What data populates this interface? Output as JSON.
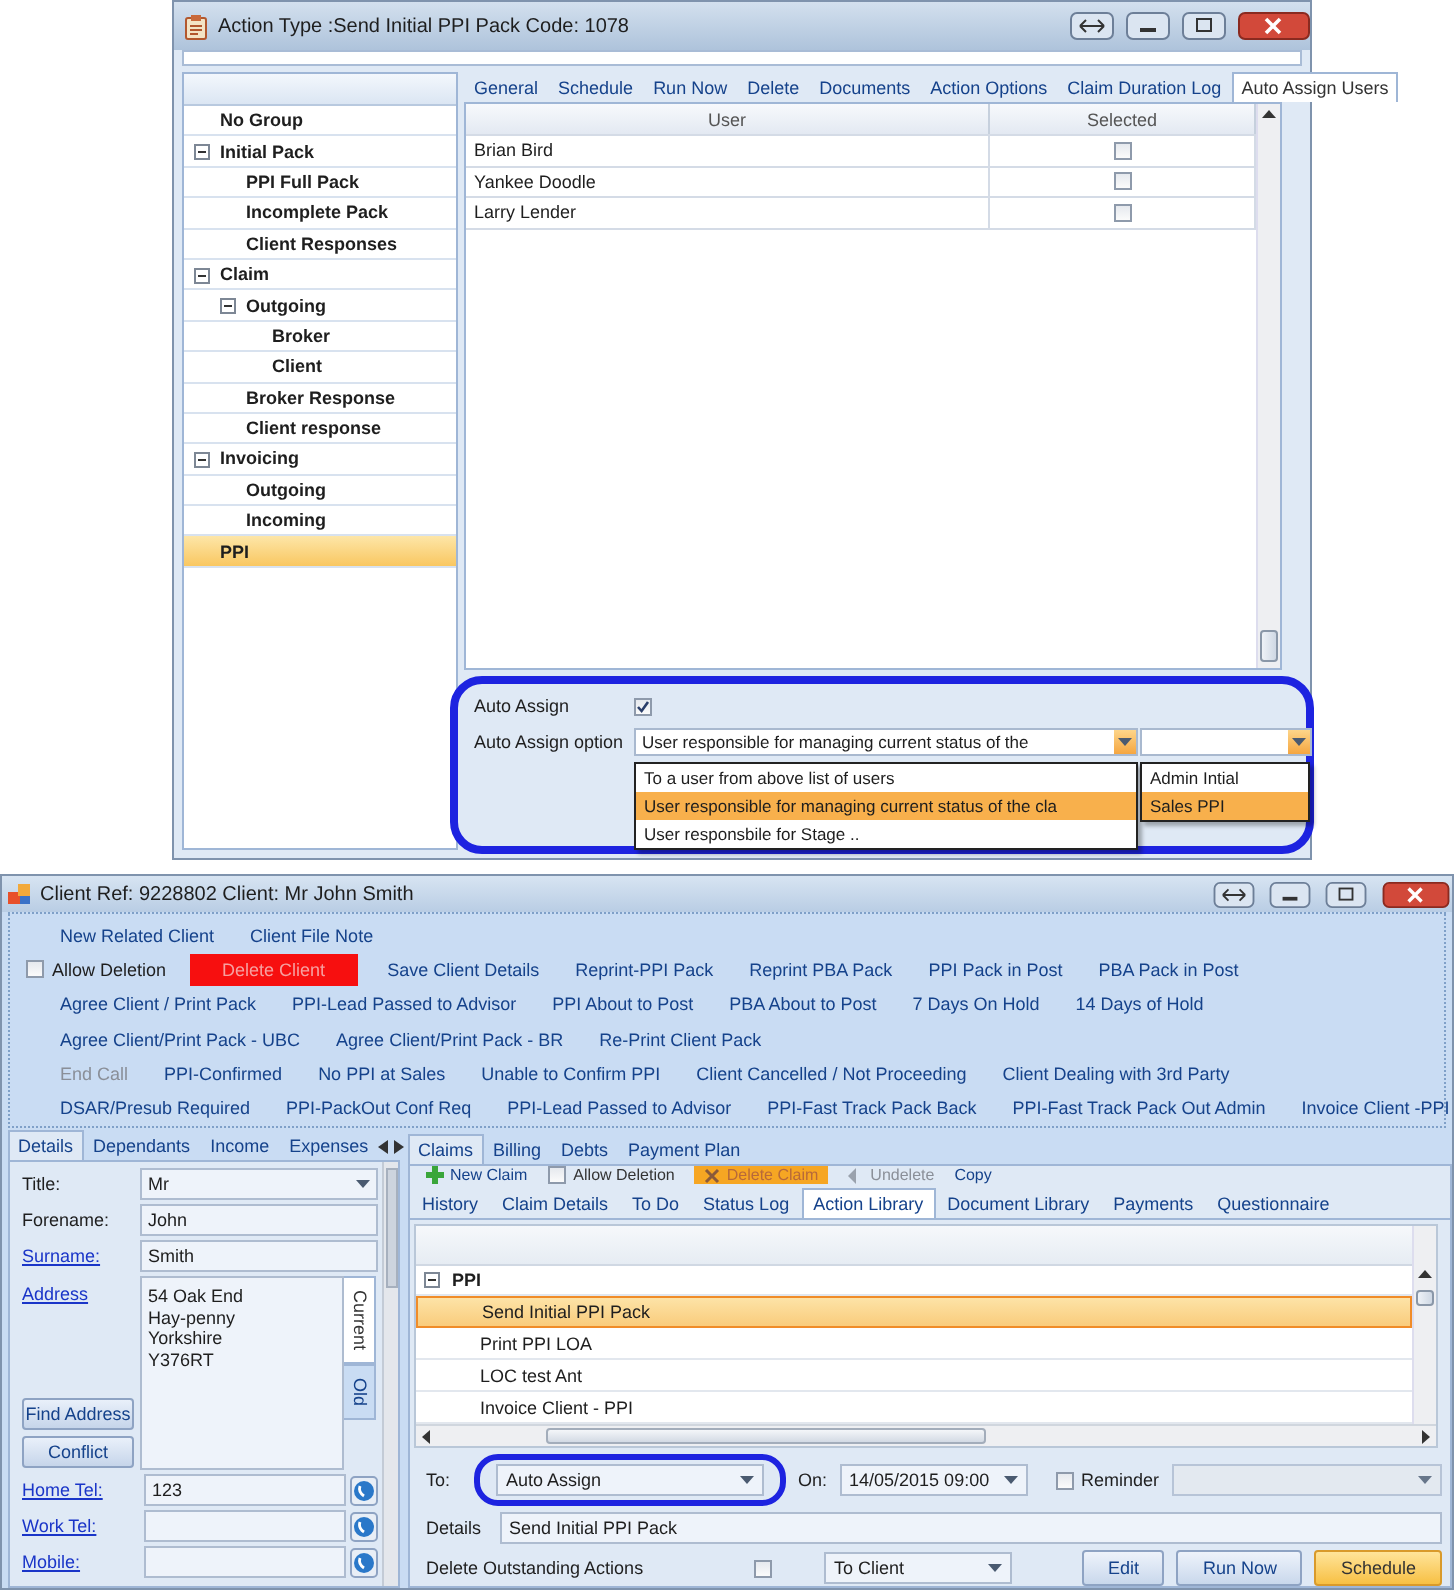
{
  "action_type_window": {
    "title": "Action Type :Send Initial PPI Pack Code: 1078",
    "tree": [
      {
        "label": "No Group",
        "selected": false
      },
      {
        "label": "Initial Pack",
        "selected": false,
        "expanded": true,
        "children": [
          {
            "label": "PPI Full Pack",
            "selected": false
          },
          {
            "label": "Incomplete Pack",
            "selected": false
          },
          {
            "label": "Client Responses",
            "selected": false
          }
        ]
      },
      {
        "label": "Claim",
        "selected": false,
        "expanded": true,
        "children": [
          {
            "label": "Outgoing",
            "selected": false,
            "expanded": true,
            "children": [
              {
                "label": "Broker",
                "selected": false
              },
              {
                "label": "Client",
                "selected": false
              }
            ]
          },
          {
            "label": "Broker Response",
            "selected": false
          },
          {
            "label": "Client response",
            "selected": false
          }
        ]
      },
      {
        "label": "Invoicing",
        "selected": false,
        "expanded": true,
        "children": [
          {
            "label": "Outgoing",
            "selected": false
          },
          {
            "label": "Incoming",
            "selected": false
          }
        ]
      },
      {
        "label": "PPI",
        "selected": true
      }
    ],
    "tabs": [
      {
        "label": "General",
        "selected": false
      },
      {
        "label": "Schedule",
        "selected": false
      },
      {
        "label": "Run Now",
        "selected": false
      },
      {
        "label": "Delete",
        "selected": false
      },
      {
        "label": "Documents",
        "selected": false
      },
      {
        "label": "Action Options",
        "selected": false
      },
      {
        "label": "Claim Duration Log",
        "selected": false
      },
      {
        "label": "Auto Assign Users",
        "selected": true
      }
    ],
    "users_table": {
      "columns": [
        "User",
        "Selected"
      ],
      "rows": [
        {
          "user": "Brian Bird",
          "checked": false
        },
        {
          "user": "Yankee Doodle",
          "checked": false
        },
        {
          "user": "Larry Lender",
          "checked": false
        }
      ]
    },
    "auto_assign": {
      "label": "Auto Assign",
      "checked": true
    },
    "auto_assign_option": {
      "label": "Auto Assign option",
      "value": "User responsible for managing current status of the",
      "options": [
        {
          "label": "To a user from above list of users",
          "selected": false
        },
        {
          "label": "User responsible for managing current status of the cla",
          "selected": true
        },
        {
          "label": "User responsbile for Stage ..",
          "selected": false
        }
      ]
    },
    "user_dropdown": {
      "options": [
        {
          "label": "Admin Intial",
          "selected": false
        },
        {
          "label": "Sales PPI",
          "selected": true
        }
      ]
    }
  },
  "client_window": {
    "title": "Client Ref: 9228802 Client: Mr John Smith",
    "action_rows": [
      [
        {
          "kind": "link",
          "label": "New Related Client"
        },
        {
          "kind": "link",
          "label": "Client File Note"
        }
      ],
      [
        {
          "kind": "checkbox",
          "label": "Allow Deletion",
          "checked": false
        },
        {
          "kind": "danger",
          "label": "Delete Client"
        },
        {
          "kind": "link",
          "label": "Save Client Details"
        },
        {
          "kind": "link",
          "label": "Reprint-PPI Pack"
        },
        {
          "kind": "link",
          "label": "Reprint PBA Pack"
        },
        {
          "kind": "link",
          "label": "PPI Pack in Post"
        },
        {
          "kind": "link",
          "label": "PBA Pack in Post"
        }
      ],
      [
        {
          "kind": "link",
          "label": "Agree Client / Print Pack"
        },
        {
          "kind": "link",
          "label": "PPI-Lead Passed to Advisor"
        },
        {
          "kind": "link",
          "label": "PPI About to Post"
        },
        {
          "kind": "link",
          "label": "PBA About to Post"
        },
        {
          "kind": "link",
          "label": "7 Days On Hold"
        },
        {
          "kind": "link",
          "label": "14 Days of Hold"
        }
      ],
      [
        {
          "kind": "link",
          "label": "Agree Client/Print Pack - UBC"
        },
        {
          "kind": "link",
          "label": "Agree Client/Print Pack - BR"
        },
        {
          "kind": "link",
          "label": "Re-Print Client Pack"
        }
      ],
      [
        {
          "kind": "disabled",
          "label": "End Call"
        },
        {
          "kind": "link",
          "label": "PPI-Confirmed"
        },
        {
          "kind": "link",
          "label": "No PPI at Sales"
        },
        {
          "kind": "link",
          "label": "Unable to Confirm PPI"
        },
        {
          "kind": "link",
          "label": "Client Cancelled / Not Proceeding"
        },
        {
          "kind": "link",
          "label": "Client Dealing with 3rd Party"
        }
      ],
      [
        {
          "kind": "link",
          "label": "DSAR/Presub Required"
        },
        {
          "kind": "link",
          "label": "PPI-PackOut Conf Req"
        },
        {
          "kind": "link",
          "label": "PPI-Lead Passed to Advisor"
        },
        {
          "kind": "link",
          "label": "PPI-Fast Track Pack Back"
        },
        {
          "kind": "link",
          "label": "PPI-Fast Track Pack Out Admin"
        },
        {
          "kind": "link",
          "label": "Invoice Client -PPI"
        }
      ]
    ],
    "left_tabs": [
      {
        "label": "Details",
        "selected": true
      },
      {
        "label": "Dependants",
        "selected": false
      },
      {
        "label": "Income",
        "selected": false
      },
      {
        "label": "Expenses",
        "selected": false
      }
    ],
    "fields": [
      {
        "label": "Title:",
        "link": false,
        "kind": "select",
        "value": "Mr"
      },
      {
        "label": "Forename:",
        "link": false,
        "kind": "text",
        "value": "John"
      },
      {
        "label": "Surname:",
        "link": true,
        "kind": "text",
        "value": "Smith"
      }
    ],
    "address": {
      "label": "Address",
      "lines": [
        "54 Oak End",
        "Hay-penny",
        "Yorkshire",
        "Y376RT"
      ],
      "tabs": [
        {
          "label": "Current",
          "selected": true
        },
        {
          "label": "Old",
          "selected": false
        }
      ],
      "buttons": [
        "Find Address",
        "Conflict"
      ]
    },
    "phones": [
      {
        "label": "Home Tel:",
        "value": "123"
      },
      {
        "label": "Work Tel:"
      },
      {
        "label": "Mobile:"
      }
    ],
    "claim_tabs": [
      {
        "label": "Claims",
        "selected": true
      },
      {
        "label": "Billing",
        "selected": false
      },
      {
        "label": "Debts",
        "selected": false
      },
      {
        "label": "Payment Plan",
        "selected": false
      }
    ],
    "claim_toolbar": [
      {
        "kind": "add",
        "label": "New Claim"
      },
      {
        "kind": "checkbox",
        "label": "Allow Deletion",
        "checked": false
      },
      {
        "kind": "delete",
        "label": "Delete Claim"
      },
      {
        "kind": "undelete",
        "label": "Undelete"
      },
      {
        "kind": "plain",
        "label": "Copy"
      }
    ],
    "sub_tabs": [
      {
        "label": "History",
        "selected": false
      },
      {
        "label": "Claim Details",
        "selected": false
      },
      {
        "label": "To Do",
        "selected": false
      },
      {
        "label": "Status Log",
        "selected": false
      },
      {
        "label": "Action Library",
        "selected": true
      },
      {
        "label": "Document Library",
        "selected": false
      },
      {
        "label": "Payments",
        "selected": false
      },
      {
        "label": "Questionnaire",
        "selected": false
      }
    ],
    "action_list": {
      "group": {
        "label": "PPI",
        "expanded": true
      },
      "rows": [
        {
          "label": "Send Initial PPI Pack",
          "selected": true
        },
        {
          "label": "Print PPI LOA",
          "selected": false
        },
        {
          "label": "LOC test Ant",
          "selected": false
        },
        {
          "label": "Invoice Client - PPI",
          "selected": false
        }
      ]
    },
    "schedule_form": {
      "to": {
        "label": "To:",
        "value": "Auto Assign"
      },
      "on": {
        "label": "On:",
        "value": "14/05/2015 09:00"
      },
      "reminder": {
        "label": "Reminder",
        "checked": false
      },
      "details": {
        "label": "Details",
        "value": "Send Initial PPI Pack"
      },
      "delete_outstanding": {
        "label": "Delete Outstanding Actions",
        "checked": false
      },
      "target": {
        "value": "To Client"
      },
      "buttons": [
        {
          "label": "Edit",
          "kind": "normal"
        },
        {
          "label": "Run Now",
          "kind": "normal"
        },
        {
          "label": "Schedule",
          "kind": "primary"
        }
      ]
    }
  }
}
